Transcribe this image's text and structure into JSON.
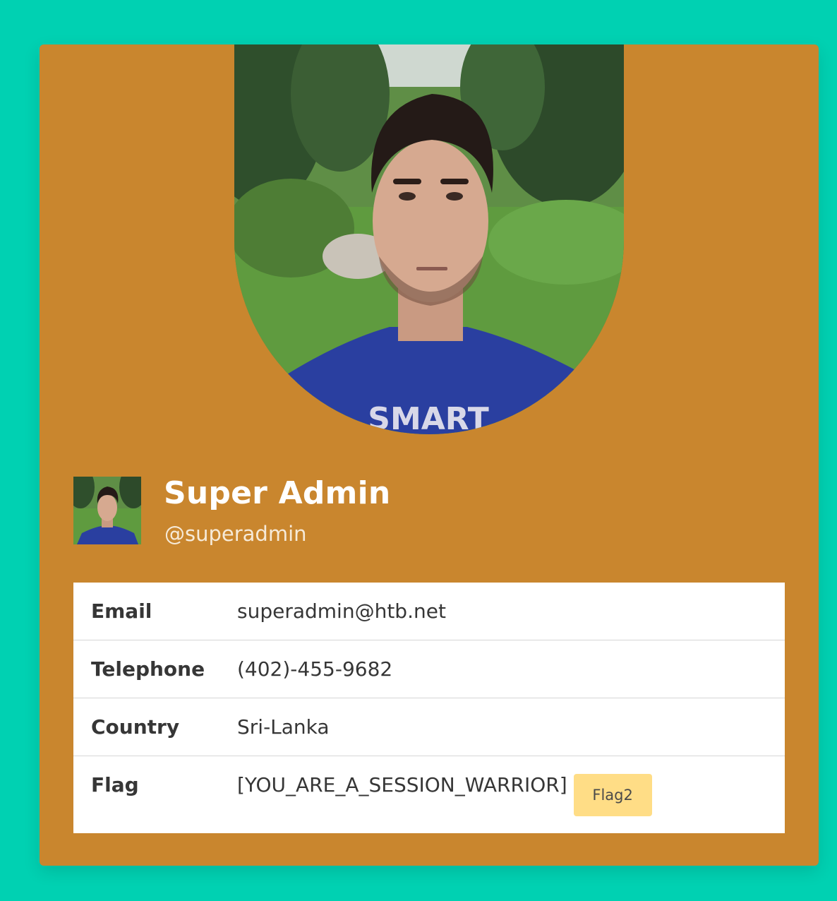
{
  "profile": {
    "name": "Super Admin",
    "handle": "@superadmin",
    "shirt_text": "SMART"
  },
  "info_table": {
    "rows": [
      {
        "label": "Email",
        "value": "superadmin@htb.net"
      },
      {
        "label": "Telephone",
        "value": "(402)-455-9682"
      },
      {
        "label": "Country",
        "value": "Sri-Lanka"
      },
      {
        "label": "Flag",
        "value": "[YOU_ARE_A_SESSION_WARRIOR]"
      }
    ],
    "flag_button_label": "Flag2"
  },
  "colors": {
    "background": "#00d1b2",
    "card": "#c9862e",
    "flag_button": "#ffdd86"
  }
}
